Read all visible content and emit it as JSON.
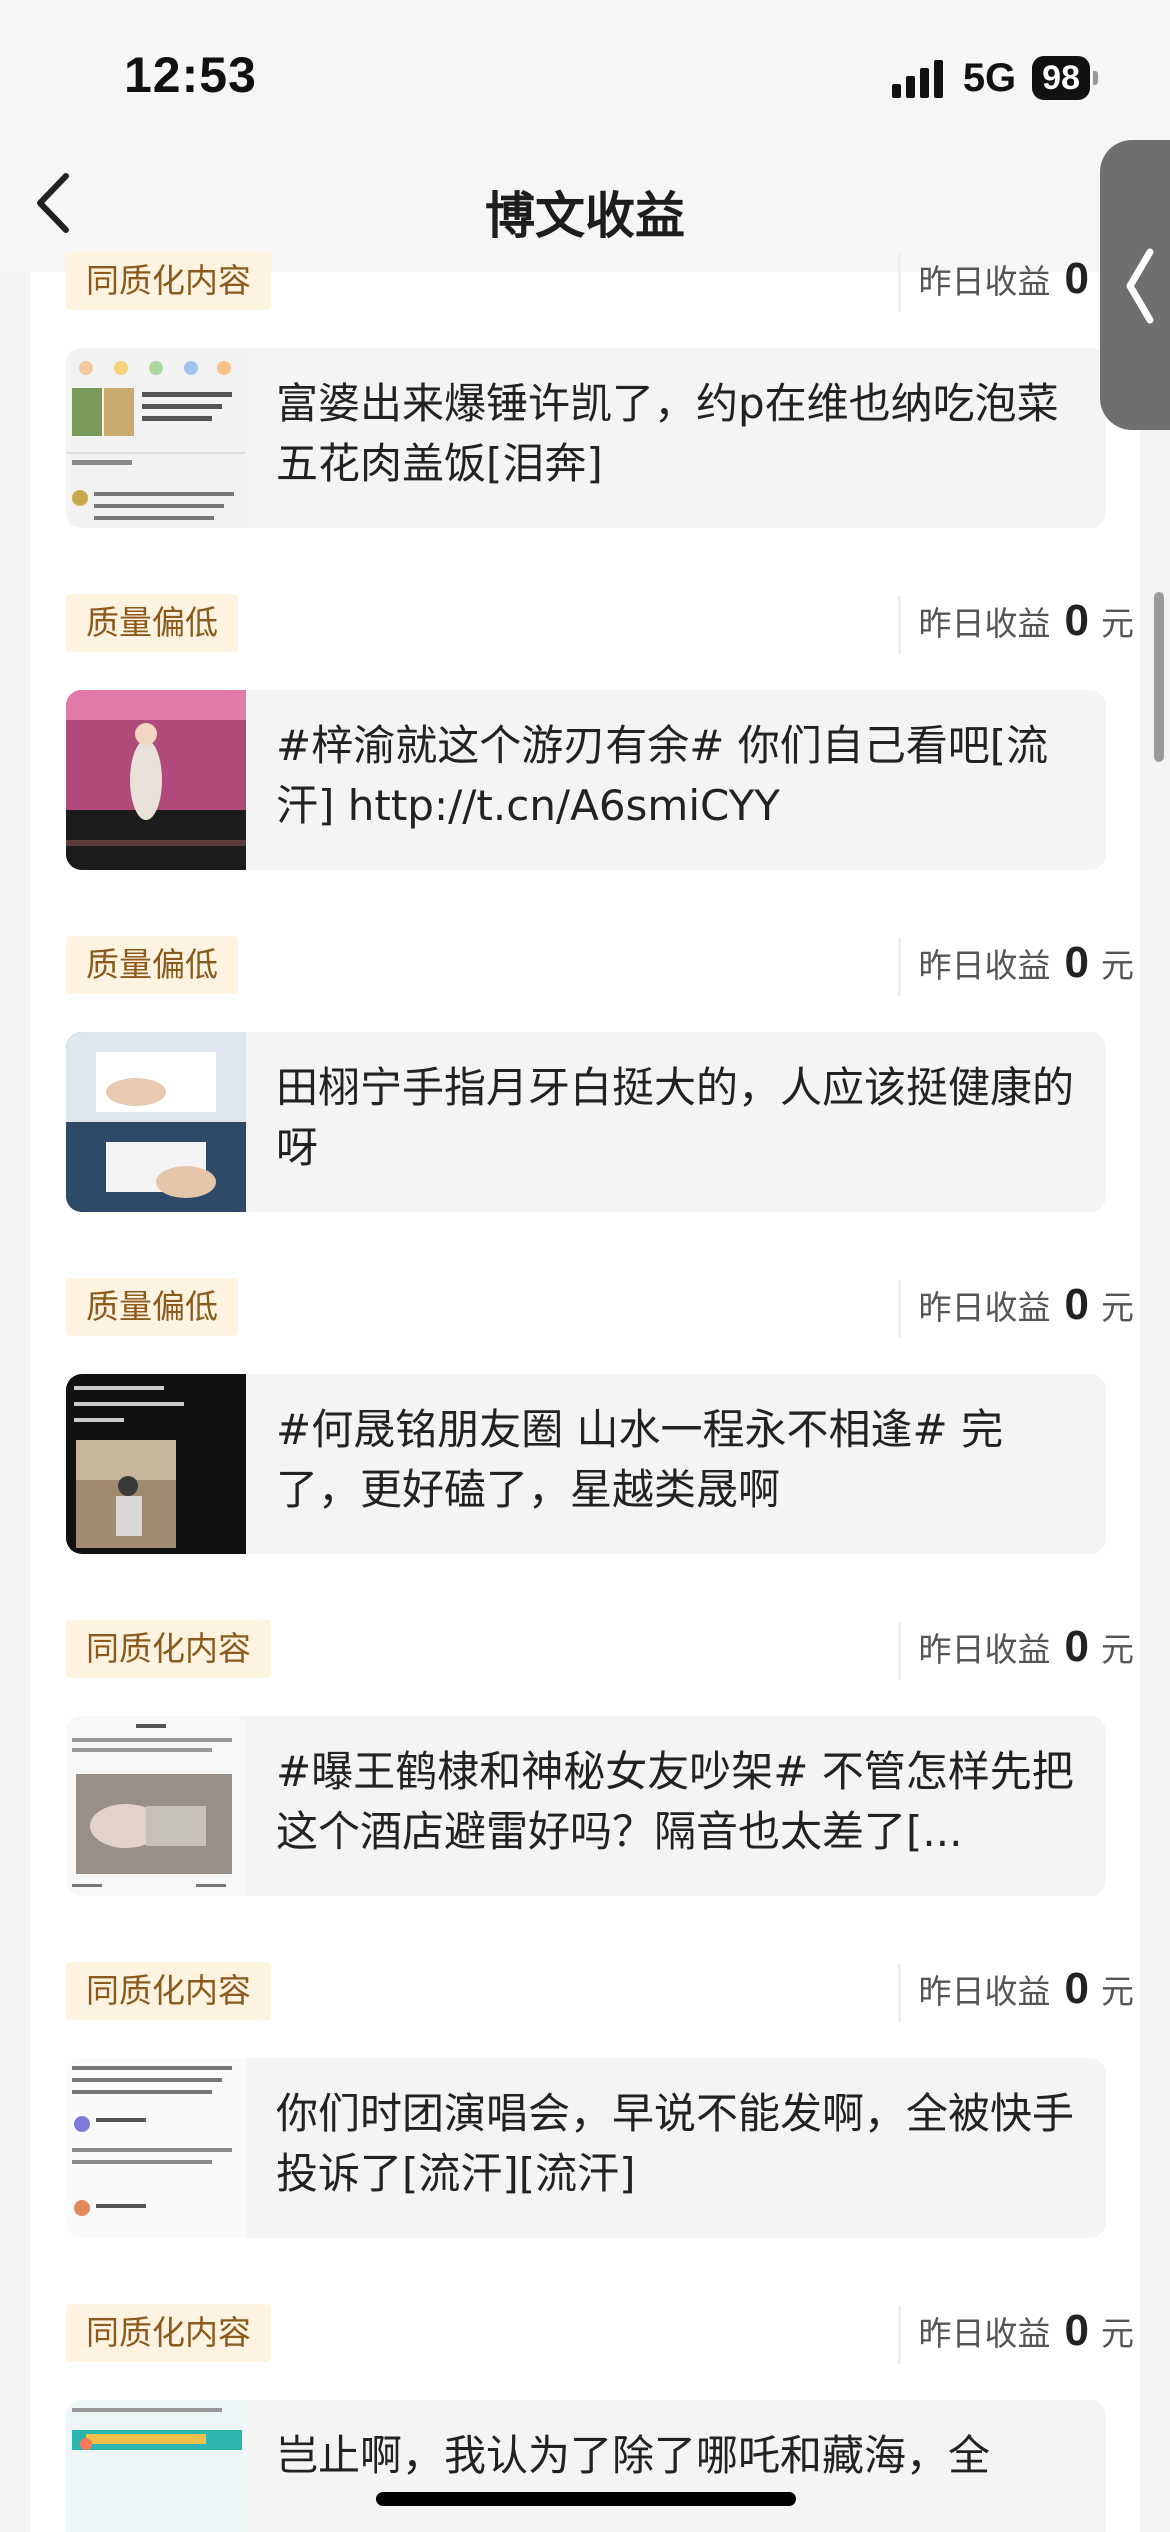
{
  "status_bar": {
    "time": "12:53",
    "network": "5G",
    "battery": "98"
  },
  "nav": {
    "title": "博文收益",
    "back_icon": "chevron-left-icon"
  },
  "earnings_label": "昨日收益",
  "earnings_unit": "元",
  "items": [
    {
      "tag": "同质化内容",
      "earnings": "0",
      "text": ""
    },
    {
      "tag": "质量偏低",
      "earnings": "0",
      "text": "富婆出来爆锤许凯了，约p在维也纳吃泡菜五花肉盖饭[泪奔]"
    },
    {
      "tag": "质量偏低",
      "earnings": "0",
      "text": "#梓渝就这个游刃有余# 你们自己看吧[流汗] http://t.cn/A6smiCYY"
    },
    {
      "tag": "质量偏低",
      "earnings": "0",
      "text": "田栩宁手指月牙白挺大的，人应该挺健康的呀"
    },
    {
      "tag": "同质化内容",
      "earnings": "0",
      "text": "#何晟铭朋友圈 山水一程永不相逢# 完了，更好磕了，星越类晟啊"
    },
    {
      "tag": "同质化内容",
      "earnings": "0",
      "text": "#曝王鹤棣和神秘女友吵架# 不管怎样先把这个酒店避雷好吗？隔音也太差了[..."
    },
    {
      "tag": "同质化内容",
      "earnings": "0",
      "text": "你们时团演唱会，早说不能发啊，全被快手投诉了[流汗][流汗]"
    },
    {
      "tag": "",
      "earnings": "",
      "text": "岂止啊，我认为了除了哪吒和藏海，全"
    }
  ],
  "colors": {
    "tag_bg": "#fdf3e0",
    "tag_text": "#8b5a1c",
    "card_bg": "#f4f4f4"
  }
}
